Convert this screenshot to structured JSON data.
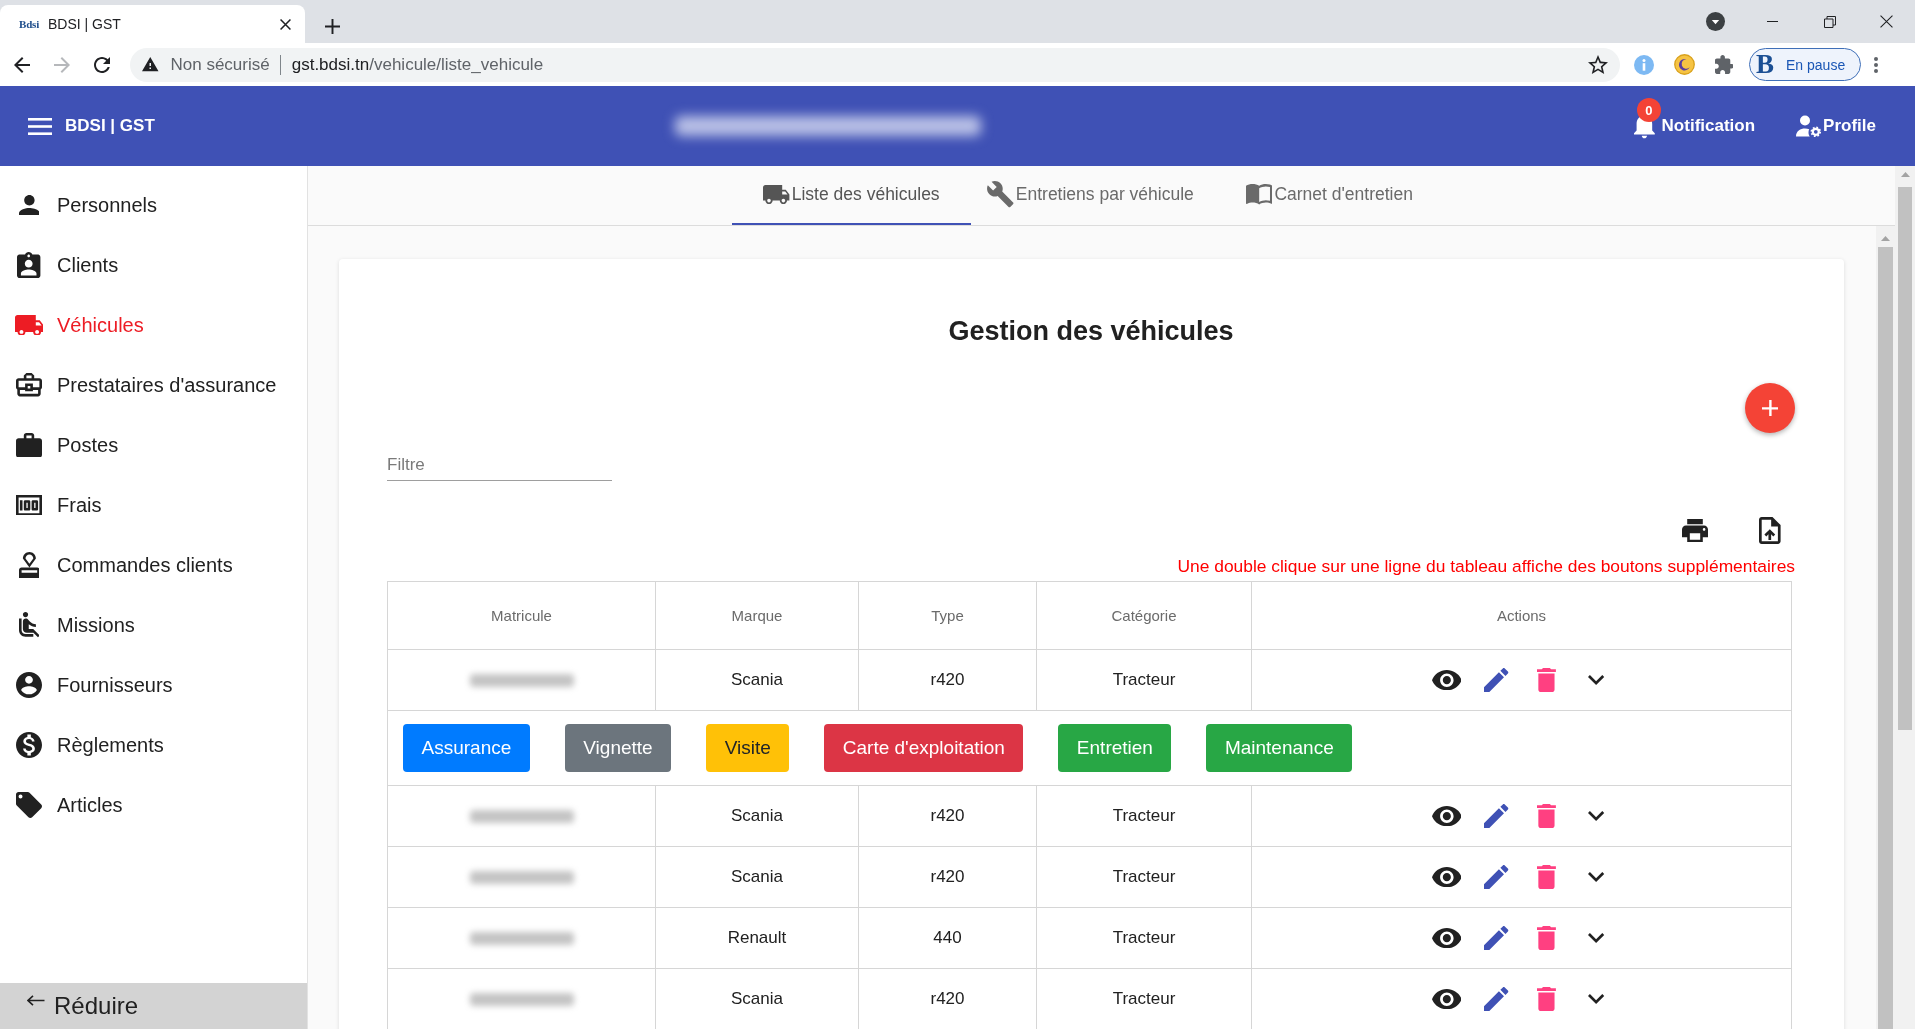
{
  "browser": {
    "tab": {
      "favicon": "Bdsi",
      "title": "BDSI | GST"
    },
    "forward": {
      "disabled": true
    },
    "security_label": "Non sécurisé",
    "url": {
      "host": "gst.bdsi.tn",
      "path": "/vehicule/liste_vehicule"
    },
    "profile": {
      "initial": "B",
      "status": "En pause"
    }
  },
  "app_bar": {
    "brand": "BDSI | GST",
    "notification": {
      "count": "0",
      "label": "Notification"
    },
    "profile": "Profile"
  },
  "sidebar": {
    "items": [
      {
        "label": "Personnels",
        "selected": false
      },
      {
        "label": "Clients",
        "selected": false
      },
      {
        "label": "Véhicules",
        "selected": true
      },
      {
        "label": "Prestataires d'assurance",
        "selected": false
      },
      {
        "label": "Postes",
        "selected": false
      },
      {
        "label": "Frais",
        "selected": false
      },
      {
        "label": "Commandes clients",
        "selected": false
      },
      {
        "label": "Missions",
        "selected": false
      },
      {
        "label": "Fournisseurs",
        "selected": false
      },
      {
        "label": "Règlements",
        "selected": false
      },
      {
        "label": "Articles",
        "selected": false
      }
    ],
    "collapse": "Réduire"
  },
  "tabs": [
    {
      "label": "Liste des véhicules",
      "selected": true
    },
    {
      "label": "Entretiens par véhicule",
      "selected": false
    },
    {
      "label": "Carnet d'entretien",
      "selected": false
    }
  ],
  "page": {
    "title": "Gestion des véhicules",
    "filter": {
      "placeholder": "Filtre"
    },
    "hint": "Une double clique sur une ligne du tableau affiche des boutons supplémentaires"
  },
  "table": {
    "columns": [
      "Matricule",
      "Marque",
      "Type",
      "Catégorie",
      "Actions"
    ],
    "rows": [
      {
        "kind": "record",
        "marque": "Scania",
        "type": "r420",
        "categorie": "Tracteur"
      },
      {
        "kind": "buttons",
        "buttons": [
          {
            "label": "Assurance",
            "color": "#007bff"
          },
          {
            "label": "Vignette",
            "color": "#6c757d"
          },
          {
            "label": "Visite",
            "color": "#ffc107"
          },
          {
            "label": "Carte d'exploitation",
            "color": "#dc3545"
          },
          {
            "label": "Entretien",
            "color": "#28a745"
          },
          {
            "label": "Maintenance",
            "color": "#28a745"
          }
        ]
      },
      {
        "kind": "record",
        "marque": "Scania",
        "type": "r420",
        "categorie": "Tracteur"
      },
      {
        "kind": "record",
        "marque": "Scania",
        "type": "r420",
        "categorie": "Tracteur"
      },
      {
        "kind": "record",
        "marque": "Renault",
        "type": "440",
        "categorie": "Tracteur"
      },
      {
        "kind": "record",
        "marque": "Scania",
        "type": "r420",
        "categorie": "Tracteur"
      }
    ]
  }
}
